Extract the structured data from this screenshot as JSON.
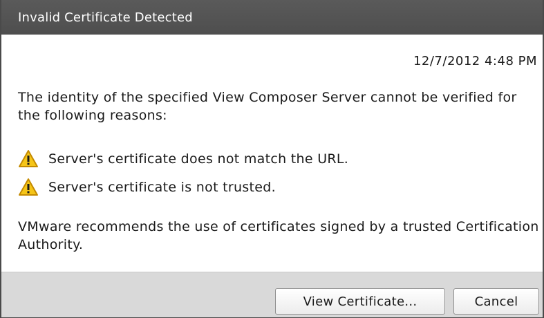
{
  "dialog": {
    "title": "Invalid Certificate Detected",
    "timestamp": "12/7/2012 4:48 PM",
    "intro": "The identity of the specified View Composer Server cannot be verified for the following reasons:",
    "reasons": [
      {
        "icon": "warning-icon",
        "text": "Server's certificate does not match the URL."
      },
      {
        "icon": "warning-icon",
        "text": "Server's certificate is not trusted."
      }
    ],
    "recommendation": "VMware recommends the use of certificates signed by a trusted Certification Authority."
  },
  "buttons": {
    "view_certificate": "View Certificate...",
    "cancel": "Cancel"
  },
  "colors": {
    "titlebar": "#4e4e4e",
    "footer": "#d9d9d9",
    "warning_fill": "#f5c518",
    "warning_stroke": "#c48a00"
  }
}
